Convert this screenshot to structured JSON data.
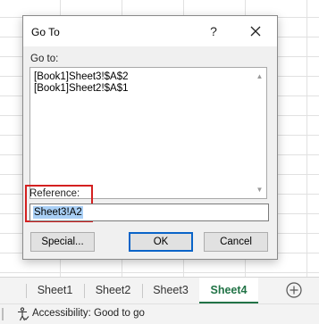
{
  "dialog": {
    "title": "Go To",
    "help_glyph": "?",
    "goto_label": "Go to:",
    "goto_items": [
      "[Book1]Sheet3!$A$2",
      "[Book1]Sheet2!$A$1"
    ],
    "reference_label": "Reference:",
    "reference_value": "Sheet3!A2",
    "buttons": {
      "special": "Special...",
      "ok": "OK",
      "cancel": "Cancel"
    }
  },
  "tabs": [
    "Sheet1",
    "Sheet2",
    "Sheet3",
    "Sheet4"
  ],
  "active_tab": "Sheet4",
  "status": {
    "accessibility": "Accessibility: Good to go"
  },
  "colors": {
    "accent_green": "#217346",
    "highlight_red": "#d42020",
    "selection_blue": "#a9cff5"
  }
}
